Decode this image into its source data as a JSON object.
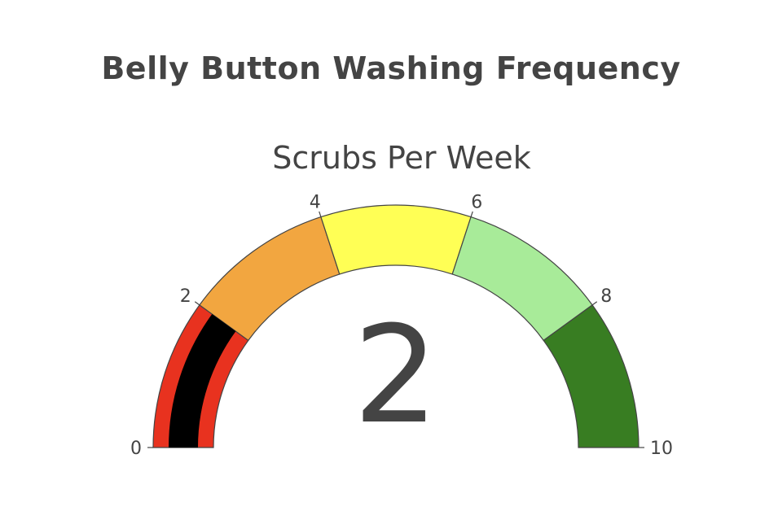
{
  "title": "Belly Button Washing Frequency",
  "chart_data": {
    "type": "gauge",
    "title": "Belly Button Washing Frequency",
    "gauge_title": "Scrubs Per Week",
    "value": 2,
    "value_text": "2",
    "range": [
      0,
      10
    ],
    "ticks": [
      {
        "value": 0,
        "label": "0"
      },
      {
        "value": 2,
        "label": "2"
      },
      {
        "value": 4,
        "label": "4"
      },
      {
        "value": 6,
        "label": "6"
      },
      {
        "value": 8,
        "label": "8"
      },
      {
        "value": 10,
        "label": "10"
      }
    ],
    "steps": [
      {
        "range": [
          0,
          2
        ],
        "color": "#E8321F"
      },
      {
        "range": [
          2,
          4
        ],
        "color": "#F2A640"
      },
      {
        "range": [
          4,
          6
        ],
        "color": "#FFFF55"
      },
      {
        "range": [
          6,
          8
        ],
        "color": "#A8EB99"
      },
      {
        "range": [
          8,
          10
        ],
        "color": "#387D22"
      }
    ],
    "bar_color": "#000000"
  }
}
